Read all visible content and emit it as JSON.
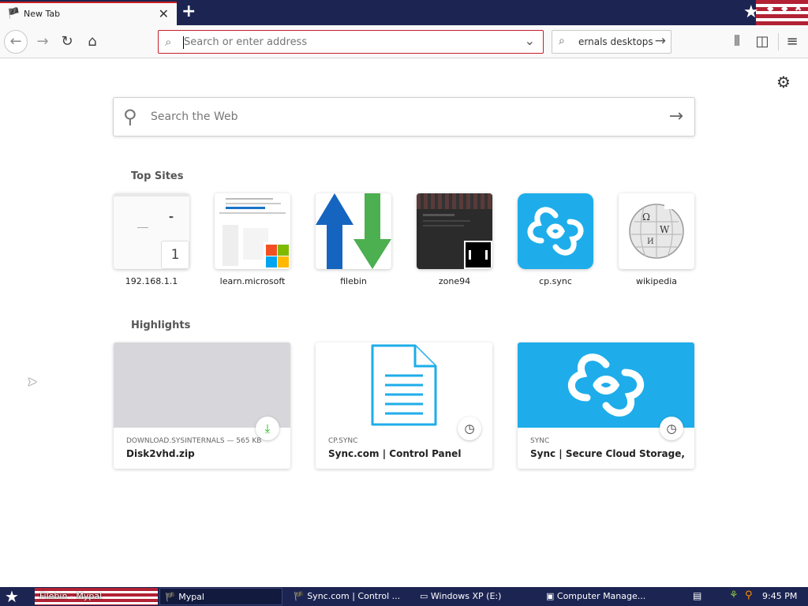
{
  "tab": {
    "title": "New Tab",
    "favicon": "flag-favicon",
    "close": "✕"
  },
  "toolbar": {
    "url_placeholder": "Search or enter address",
    "search_text": "ernals desktops"
  },
  "websearch": {
    "placeholder": "Search the Web"
  },
  "top_sites": {
    "title": "Top Sites",
    "items": [
      {
        "label": "192.168.1.1",
        "pin": "1"
      },
      {
        "label": "learn.microsoft"
      },
      {
        "label": "filebin"
      },
      {
        "label": "zone94"
      },
      {
        "label": "cp.sync"
      },
      {
        "label": "wikipedia"
      }
    ]
  },
  "highlights": {
    "title": "Highlights",
    "items": [
      {
        "source": "DOWNLOAD.SYSINTERNALS — 565 KB",
        "title": "Disk2vhd.zip",
        "badge": "download-icon"
      },
      {
        "source": "CP.SYNC",
        "title": "Sync.com | Control Panel",
        "badge": "history-icon"
      },
      {
        "source": "SYNC",
        "title": "Sync | Secure Cloud Storage, File...",
        "badge": "history-icon"
      }
    ]
  },
  "taskbar": {
    "items": [
      {
        "label": "Filebin - Mypal"
      },
      {
        "label": "Mypal"
      },
      {
        "label": "Sync.com | Control ..."
      },
      {
        "label": "Windows XP (E:)"
      },
      {
        "label": "Computer Manage..."
      }
    ],
    "clock": "9:45 PM"
  },
  "colors": {
    "accent": "#c81c2c",
    "sync_blue": "#1eadea",
    "download_green": "#12bc00",
    "taskbar": "#1c2552"
  }
}
